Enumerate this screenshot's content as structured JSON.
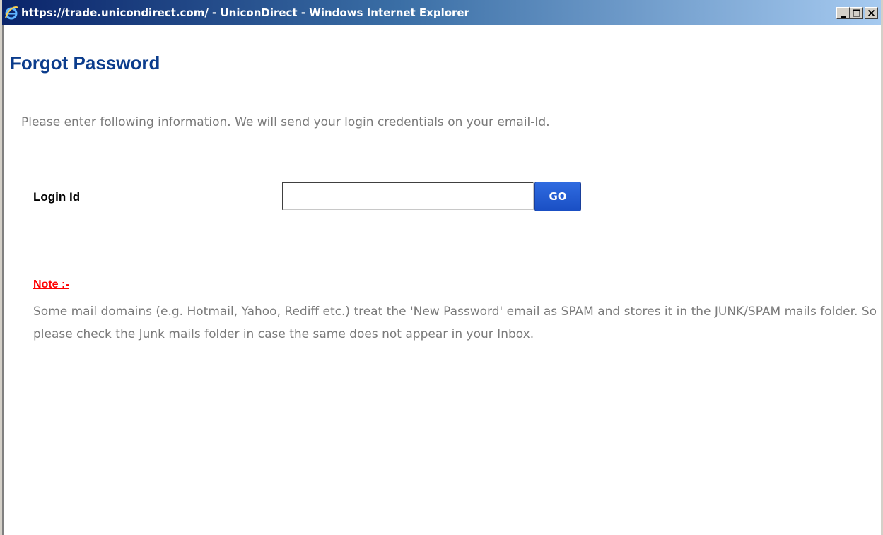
{
  "window": {
    "title": "https://trade.unicondirect.com/ - UniconDirect - Windows Internet Explorer",
    "app_icon": "internet-explorer-icon",
    "controls": [
      "minimize-icon",
      "maximize-icon",
      "close-icon"
    ]
  },
  "page": {
    "title": "Forgot Password",
    "intro": "Please enter following information. We will send your login credentials on your email-Id.",
    "form": {
      "login_label": "Login Id",
      "login_value": "",
      "go_label": "GO"
    },
    "note": {
      "heading": "Note :-",
      "body": "Some mail domains (e.g. Hotmail, Yahoo, Rediff etc.) treat the 'New Password' email as SPAM and stores it in the JUNK/SPAM mails folder. So please check the Junk mails folder in case the same does not appear in your Inbox."
    }
  },
  "colors": {
    "title_blue": "#0b3c8c",
    "note_red": "#ff0000",
    "body_gray": "#7a7a7a",
    "button_blue": "#2f6be0"
  }
}
